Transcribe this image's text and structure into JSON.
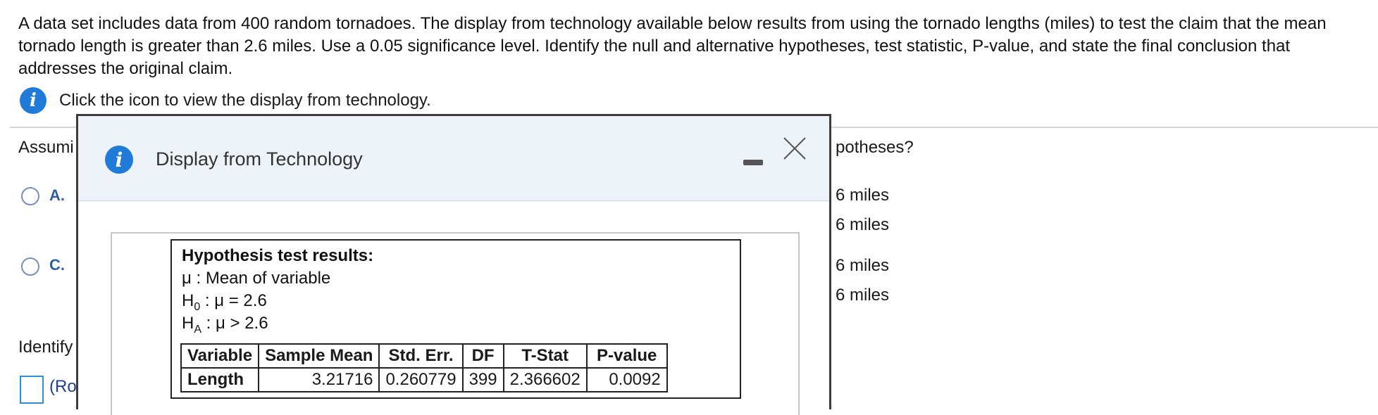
{
  "question": {
    "text": "A data set includes data from 400 random tornadoes. The display from technology available below results from using the tornado lengths (miles) to test the claim that the mean tornado length is greater than 2.6 miles. Use a 0.05 significance level. Identify the null and alternative hypotheses, test statistic, P-value, and state the final conclusion that addresses the original claim."
  },
  "info_row": {
    "icon": "info-icon",
    "text": "Click the icon to view the display from technology."
  },
  "page_fragments": {
    "assume": "Assumi",
    "hypotheses_tail": "potheses?",
    "identify": "Identify",
    "round": "(Ro"
  },
  "options": [
    {
      "letter": "A.",
      "lines": [
        "6 miles",
        "6 miles"
      ]
    },
    {
      "letter": "C.",
      "lines": [
        "6 miles",
        "6 miles"
      ]
    }
  ],
  "dialog": {
    "title": "Display from Technology",
    "icon": "info-icon",
    "output": {
      "heading": "Hypothesis test results:",
      "mu_def": "μ : Mean of variable",
      "h0_prefix": "H",
      "h0_sub": "0",
      "h0_rest": " : μ = 2.6",
      "ha_prefix": "H",
      "ha_sub": "A",
      "ha_rest": " : μ > 2.6",
      "table": {
        "headers": [
          "Variable",
          "Sample Mean",
          "Std. Err.",
          "DF",
          "T-Stat",
          "P-value"
        ],
        "row": [
          "Length",
          "3.21716",
          "0.260779",
          "399",
          "2.366602",
          "0.0092"
        ]
      }
    }
  }
}
